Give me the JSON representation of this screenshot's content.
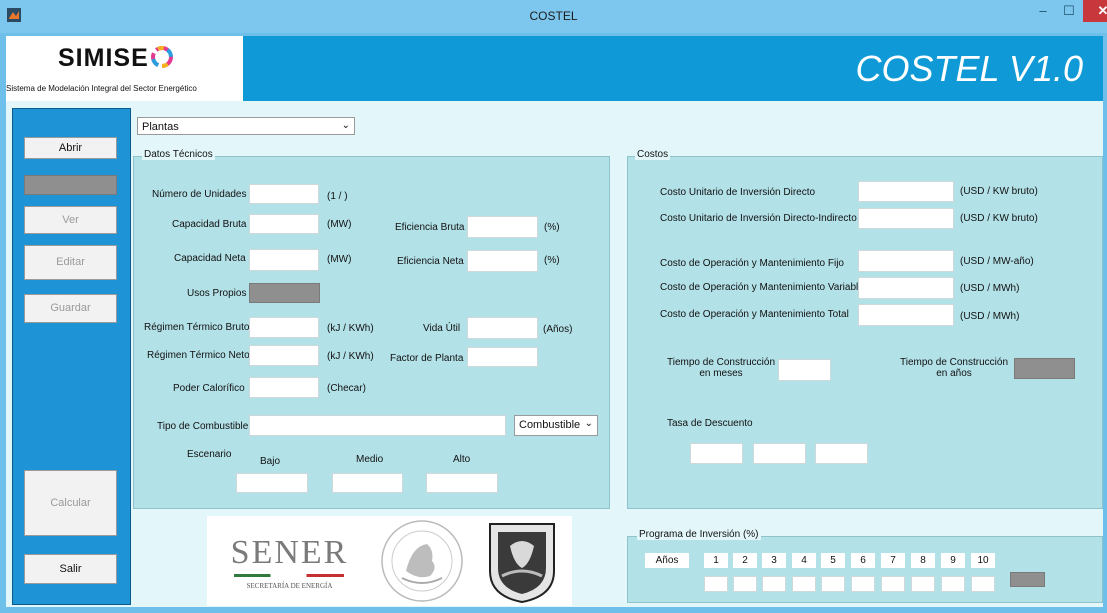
{
  "window": {
    "title": "COSTEL",
    "minimize_glyph": "–",
    "maximize_glyph": "☐",
    "close_glyph": "✕"
  },
  "header": {
    "logo_text": "SIMISE",
    "subtitle": "Sistema de Modelación Integral del Sector Energético",
    "version": "COSTEL V1.0"
  },
  "sidebar": {
    "open": "Abrir",
    "view": "Ver",
    "edit": "Editar",
    "save": "Guardar",
    "calculate": "Calcular",
    "exit": "Salir"
  },
  "type_select": {
    "value": "Plantas"
  },
  "technical": {
    "legend": "Datos Técnicos",
    "num_units": {
      "label": "Número de Unidades",
      "unit": "(1 / )"
    },
    "gross_capacity": {
      "label": "Capacidad Bruta",
      "unit": "(MW)"
    },
    "net_capacity": {
      "label": "Capacidad Neta",
      "unit": "(MW)"
    },
    "own_uses": {
      "label": "Usos Propios"
    },
    "gross_heat_rate": {
      "label": "Régimen Térmico Bruto",
      "unit": "(kJ / KWh)"
    },
    "net_heat_rate": {
      "label": "Régimen Térmico Neto",
      "unit": "(kJ / KWh)"
    },
    "calorific_power": {
      "label": "Poder Calorífico",
      "unit": "(Checar)"
    },
    "gross_efficiency": {
      "label": "Eficiencia Bruta",
      "unit": "(%)"
    },
    "net_efficiency": {
      "label": "Eficiencia Neta",
      "unit": "(%)"
    },
    "useful_life": {
      "label": "Vida Útil",
      "unit": "(Años)"
    },
    "plant_factor": {
      "label": "Factor de Planta"
    },
    "fuel_type": {
      "label": "Tipo de Combustible",
      "select_value": "Combustible"
    },
    "scenario": {
      "label": "Escenario",
      "low": "Bajo",
      "medium": "Medio",
      "high": "Alto"
    }
  },
  "costs": {
    "legend": "Costos",
    "direct_investment": {
      "label": "Costo Unitario de Inversión Directo",
      "unit": "(USD / KW bruto)"
    },
    "direct_indirect_investment": {
      "label": "Costo Unitario de Inversión Directo-Indirecto",
      "unit": "(USD / KW bruto)"
    },
    "fixed_om": {
      "label": "Costo de Operación y Mantenimiento Fijo",
      "unit": "(USD / MW-año)"
    },
    "variable_om": {
      "label": "Costo de Operación y Mantenimiento Variable",
      "unit": "(USD / MWh)"
    },
    "total_om": {
      "label": "Costo de Operación y Mantenimiento Total",
      "unit": "(USD / MWh)"
    },
    "construction_months": {
      "line1": "Tiempo de Construcción",
      "line2": "en meses"
    },
    "construction_years": {
      "line1": "Tiempo de Construcción",
      "line2": "en años"
    },
    "discount_rate": {
      "label": "Tasa de Descuento"
    }
  },
  "investment_program": {
    "legend": "Programa de Inversión (%)",
    "years_label": "Años",
    "years": [
      "1",
      "2",
      "3",
      "4",
      "5",
      "6",
      "7",
      "8",
      "9",
      "10"
    ]
  },
  "logos": {
    "sener": "SENER",
    "sener_sub": "SECRETARÍA DE ENERGÍA"
  },
  "colors": {
    "titlebar": "#7dc7ee",
    "banner": "#0f9ad7",
    "sidebar": "#1e93d6",
    "panel": "#b3e1e8",
    "close": "#c7373b"
  }
}
